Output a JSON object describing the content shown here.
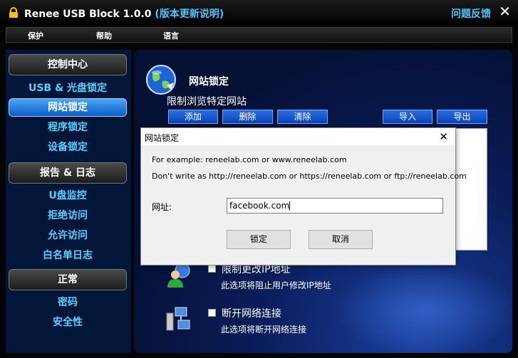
{
  "window": {
    "title": "Renee USB Block 1.0.0",
    "update_link": "(版本更新说明)",
    "feedback": "问题反馈",
    "close_glyph": "✕",
    "lock_icon": "lock-icon"
  },
  "menu": [
    "保护",
    "帮助",
    "语言"
  ],
  "sidebar": {
    "sections": [
      {
        "header": "控制中心",
        "items": [
          "USB & 光盘锁定",
          "网站锁定",
          "程序锁定",
          "设备锁定"
        ]
      },
      {
        "header": "报告 & 日志",
        "items": [
          "U盘监控",
          "拒绝访问",
          "允许访问",
          "白名单日志"
        ]
      },
      {
        "header": "正常",
        "items": [
          "密码",
          "安全性"
        ]
      }
    ],
    "active_item": "网站锁定"
  },
  "main": {
    "section_title": "网站锁定",
    "section_desc": "限制浏览特定网站",
    "toolbar": {
      "add": "添加",
      "delete": "删除",
      "clear": "清除",
      "import": "导入",
      "export": "导出"
    },
    "options": [
      {
        "title": "限制更改IP地址",
        "desc": "此选项将阻止用户修改IP地址",
        "checked": false
      },
      {
        "title": "断开网络连接",
        "desc": "此选项将断开网络连接",
        "checked": false
      }
    ]
  },
  "dialog": {
    "title": "网站锁定",
    "close_glyph": "✕",
    "example_text": "For example: reneelab.com or www.reneelab.com",
    "warning_text": "Don't write as http://reneelab.com or https://reneelab.com or ftp://reneelab.com",
    "url_label": "网址:",
    "url_value": "facebook.com",
    "lock_button": "锁定",
    "cancel_button": "取消"
  },
  "colors": {
    "accent": "#4fc2ff",
    "active": "#2d8ae8",
    "panel": "#0a1d5a"
  }
}
